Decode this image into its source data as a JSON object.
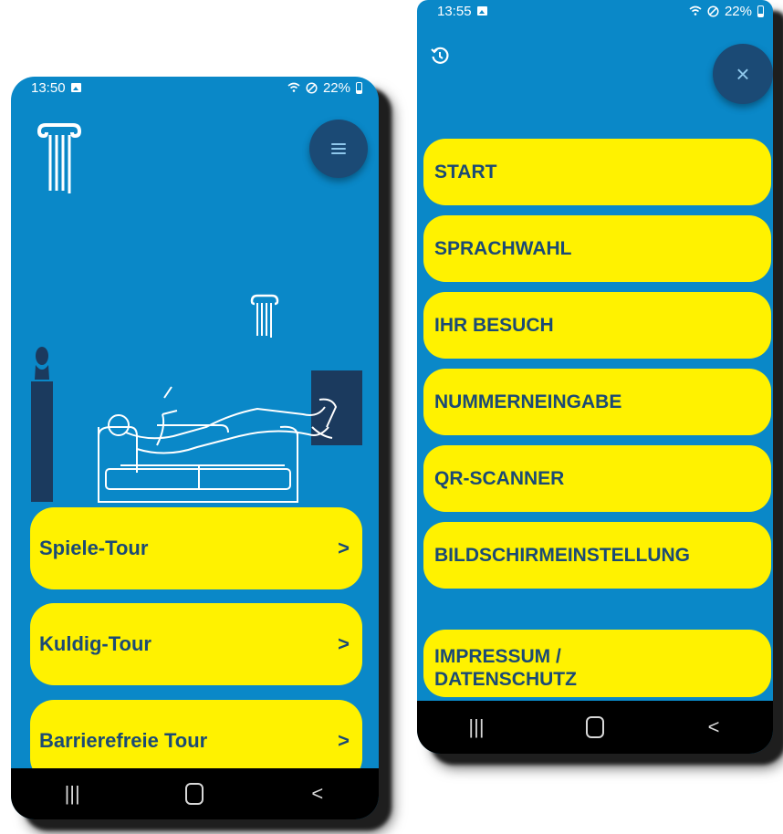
{
  "left_screen": {
    "status": {
      "time": "13:50",
      "battery": "22%"
    },
    "tour_buttons": [
      {
        "label": "Spiele-Tour",
        "chevron": ">"
      },
      {
        "label": "Kuldig-Tour",
        "chevron": ">"
      },
      {
        "label": "Barrierefreie Tour",
        "chevron": ">"
      }
    ]
  },
  "right_screen": {
    "status": {
      "time": "13:55",
      "battery": "22%"
    },
    "menu_items": [
      "START",
      "SPRACHWAHL",
      "IHR BESUCH",
      "NUMMERNEINGABE",
      "QR-SCANNER",
      "BILDSCHIRMEINSTELLUNG"
    ],
    "footer_item_lines": [
      "IMPRESSUM /",
      "DATENSCHUTZ"
    ],
    "close_label": "×"
  },
  "navigation": {
    "recents": "|||",
    "back": "<"
  },
  "colors": {
    "background": "#0a88c8",
    "button": "#fff200",
    "text": "#1b4a75",
    "fab": "#1b4a75",
    "navbar": "#000000"
  },
  "icons": {
    "logo": "column-logo-icon",
    "menu": "hamburger-menu-icon",
    "close": "close-icon",
    "history": "history-icon"
  }
}
